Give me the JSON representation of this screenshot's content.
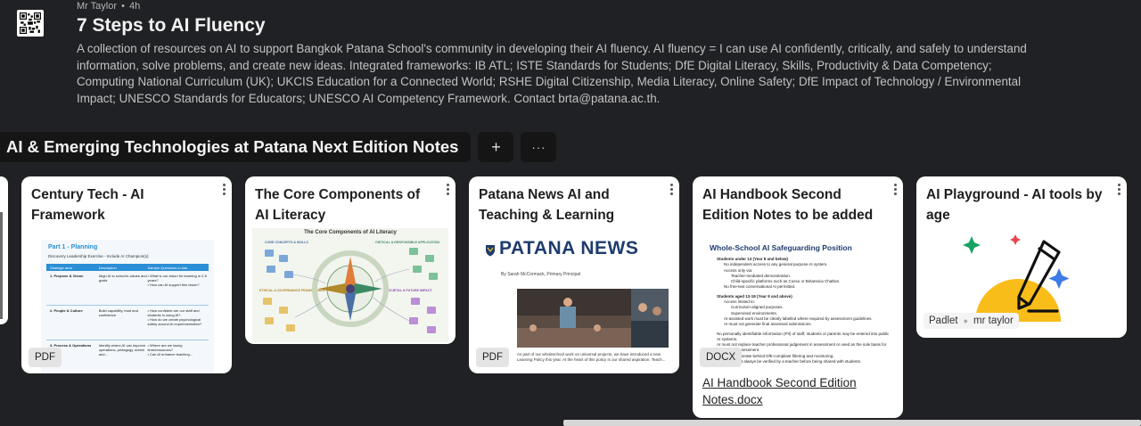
{
  "header": {
    "author": "Mr Taylor",
    "separator": "•",
    "time_ago": "4h",
    "title": "7 Steps to AI Fluency",
    "description": "A collection of resources on AI to support Bangkok Patana School's community in developing their AI fluency. AI fluency = I can use AI confidently, critically, and safely to understand information, solve problems, and create new ideas. Integrated frameworks: IB ATL; ISTE Standards for Students; DfE Digital Literacy, Skills, Productivity & Data Competency; Computing National Curriculum (UK); UKCIS Education for a Connected World; RSHE Digital Citizenship, Media Literacy, Online Safety; DfE Impact of Technology / Environmental Impact; UNESCO Standards for Educators; UNESCO AI Competency Framework. Contact brta@patana.ac.th."
  },
  "section": {
    "title": "AI & Emerging Technologies at Patana Next Edition Notes",
    "add_label": "+",
    "more_label": "···"
  },
  "cards": [
    {
      "title": "Century Tech - AI Framework",
      "badge": "PDF",
      "preview": {
        "heading": "Part 1 - Planning",
        "subheading": "Discovery Leadership Exercise - Include AI Champion(s)",
        "columns": [
          "Strategic area",
          "Description",
          "Sample Questions to Ask"
        ],
        "rows": [
          [
            "1. Purpose & Vision",
            "Align AI to school's values and goals",
            "• What is our vision for learning in 2-5 years?\n• How can AI support this vision?"
          ],
          [
            "2. People & Culture",
            "Build capability, trust and confidence",
            "• How confident are our staff and students in using AI?\n• How do we create psychological safety around AI experimentation?"
          ],
          [
            "3. Process & Operations",
            "Identify where AI can improve operations, pedagogy, admin and...",
            "• Where are we losing time/resources?\n• Can AI enhance teaching..."
          ]
        ]
      }
    },
    {
      "title": "The Core Components of AI Literacy",
      "preview": {
        "heading": "The Core Components of AI Literacy",
        "labels": [
          "CORE CONCEPTS & SKILLS",
          "CRITICAL & RESPONSIBLE APPLICATION",
          "ETHICAL & GOVERNANCE FRAMEWORKS",
          "SOCIETAL & FUTURE IMPACT"
        ]
      }
    },
    {
      "title": "Patana News AI and Teaching & Learning",
      "badge": "PDF",
      "preview": {
        "masthead": "PATANA NEWS",
        "byline": "By Sarah McCormack, Primary Principal",
        "body": "As part of our wholeschool work on universal projects, we have introduced a new Learning Policy this year. At the heart of this policy is our shared aspiration. Teach..."
      }
    },
    {
      "title": "AI Handbook Second Edition Notes to be added",
      "badge": "DOCX",
      "file_name": "AI Handbook Second Edition Notes.docx",
      "preview": {
        "heading": "Whole-School AI Safeguarding Position",
        "lines": [
          "Students under 13 (Year 8 and below)",
          "No independent access to any general purpose AI system.",
          "Access only via:",
          "Teacher-mediated demonstration.",
          "Child-specific platforms such as Cusso or Britannica Chatbot.",
          "No free-text conversational AI permitted.",
          "Students aged 13-18 (Year 9 and above)",
          "Access limited to:",
          "Curriculum-aligned purposes.",
          "Supervised environments.",
          "AI-assisted work must be clearly labelled where required by assessment guidelines.",
          "AI must not generate final assessed submissions.",
          "No personally identifiable information (PII) of staff, students or parents may be entered into public AI systems.",
          "AI must not replace teacher professional judgement in assessment or used as the sole basis for summative assessment.",
          "AI must not operate behind DfE-compliant filtering and monitoring.",
          "AI output must always be verified by a teacher before being shared with students."
        ]
      }
    },
    {
      "title": "AI Playground - AI tools by age",
      "source": "Padlet",
      "author": "mr taylor",
      "colors": {
        "sun": "#f9bd1a",
        "spark_green": "#1aa260",
        "spark_red": "#e8454f",
        "spark_blue": "#3d7be8"
      }
    }
  ],
  "colors": {
    "background": "#202124",
    "card": "#ffffff",
    "section_bar": "#151515",
    "patana_blue": "#1f3c6e"
  }
}
